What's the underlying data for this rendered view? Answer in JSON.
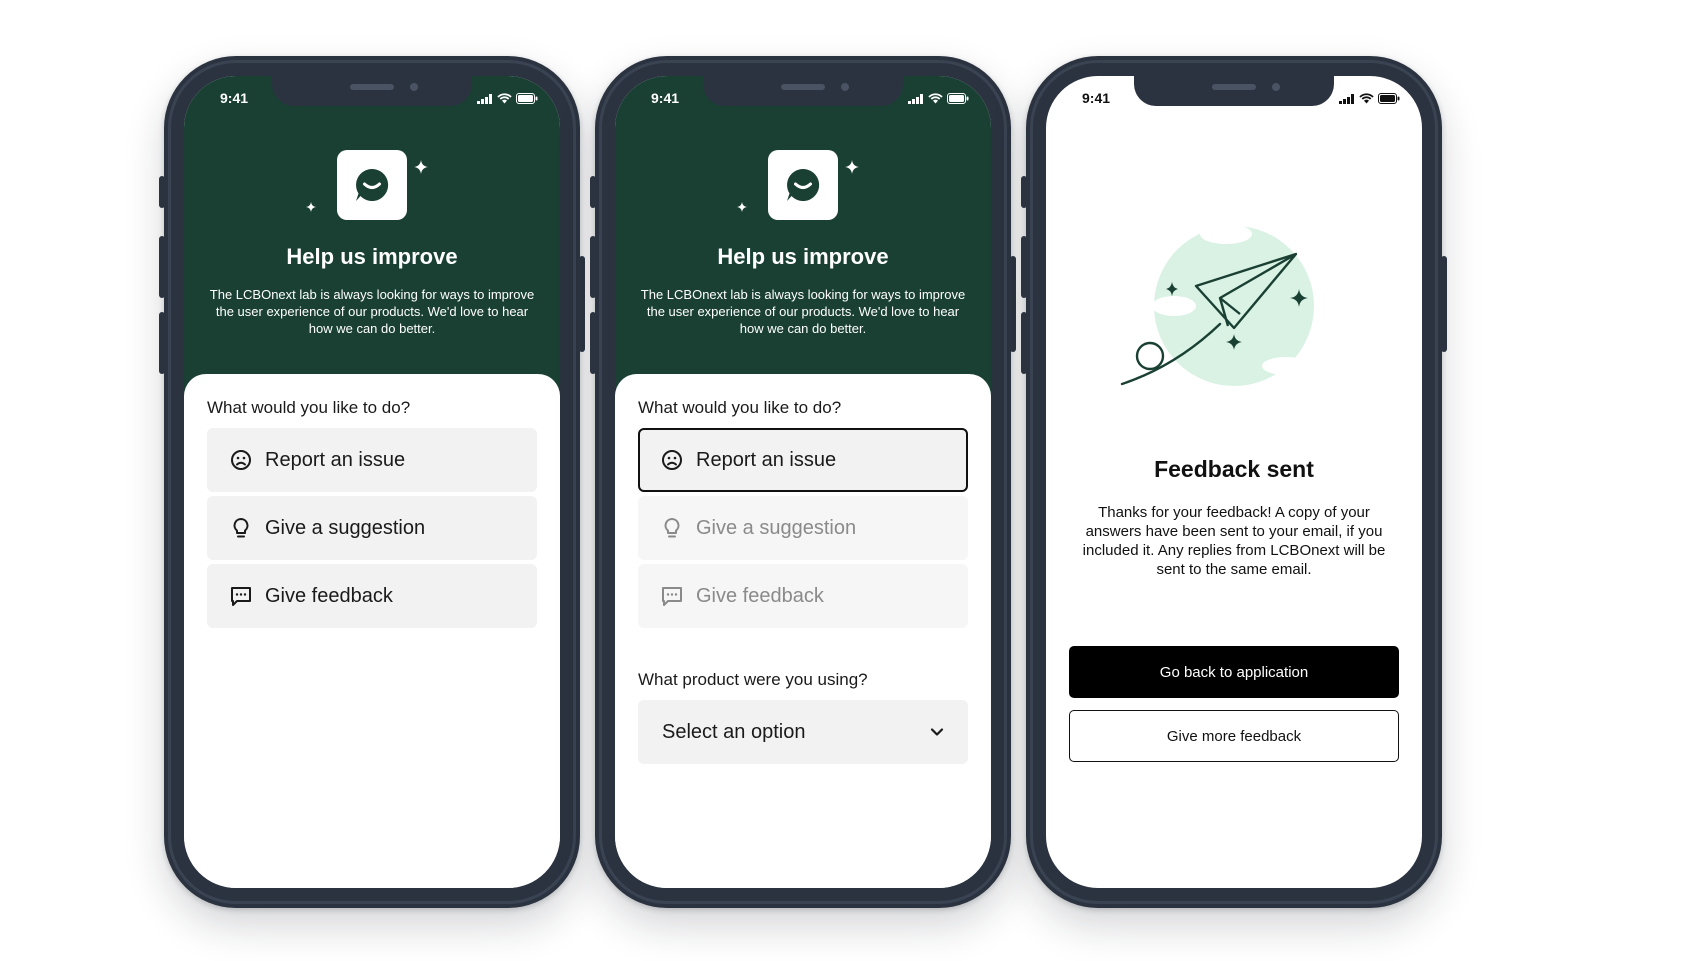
{
  "status_time": "9:41",
  "colors": {
    "header_green": "#1a4034",
    "illustration_mint": "#d9f2e4",
    "text_dark": "#111111"
  },
  "screen1": {
    "title": "Help us improve",
    "description": "The LCBOnext lab is always looking for ways to improve the user experience of our products. We'd love to hear how we can do better.",
    "question": "What would you like to do?",
    "options": [
      {
        "label": "Report an issue",
        "icon": "sad-face-icon"
      },
      {
        "label": "Give a suggestion",
        "icon": "lightbulb-icon"
      },
      {
        "label": "Give feedback",
        "icon": "chat-bubble-icon"
      }
    ]
  },
  "screen2": {
    "title": "Help us improve",
    "description": "The LCBOnext lab is always looking for ways to improve the user experience of our products. We'd love to hear how we can do better.",
    "question": "What would you like to do?",
    "options": [
      {
        "label": "Report an issue",
        "icon": "sad-face-icon",
        "state": "selected"
      },
      {
        "label": "Give a suggestion",
        "icon": "lightbulb-icon",
        "state": "disabled"
      },
      {
        "label": "Give feedback",
        "icon": "chat-bubble-icon",
        "state": "disabled"
      }
    ],
    "product_question": "What product were you using?",
    "product_select": {
      "value": "Select an option",
      "icon": "chevron-down-icon"
    }
  },
  "screen3": {
    "title": "Feedback sent",
    "description": "Thanks for your feedback! A copy of your answers have been sent to your email, if you included it. Any replies from LCBOnext will be sent to the same email.",
    "primary_button": "Go back to application",
    "secondary_button": "Give more feedback",
    "illustration": "paper-plane-illustration"
  }
}
